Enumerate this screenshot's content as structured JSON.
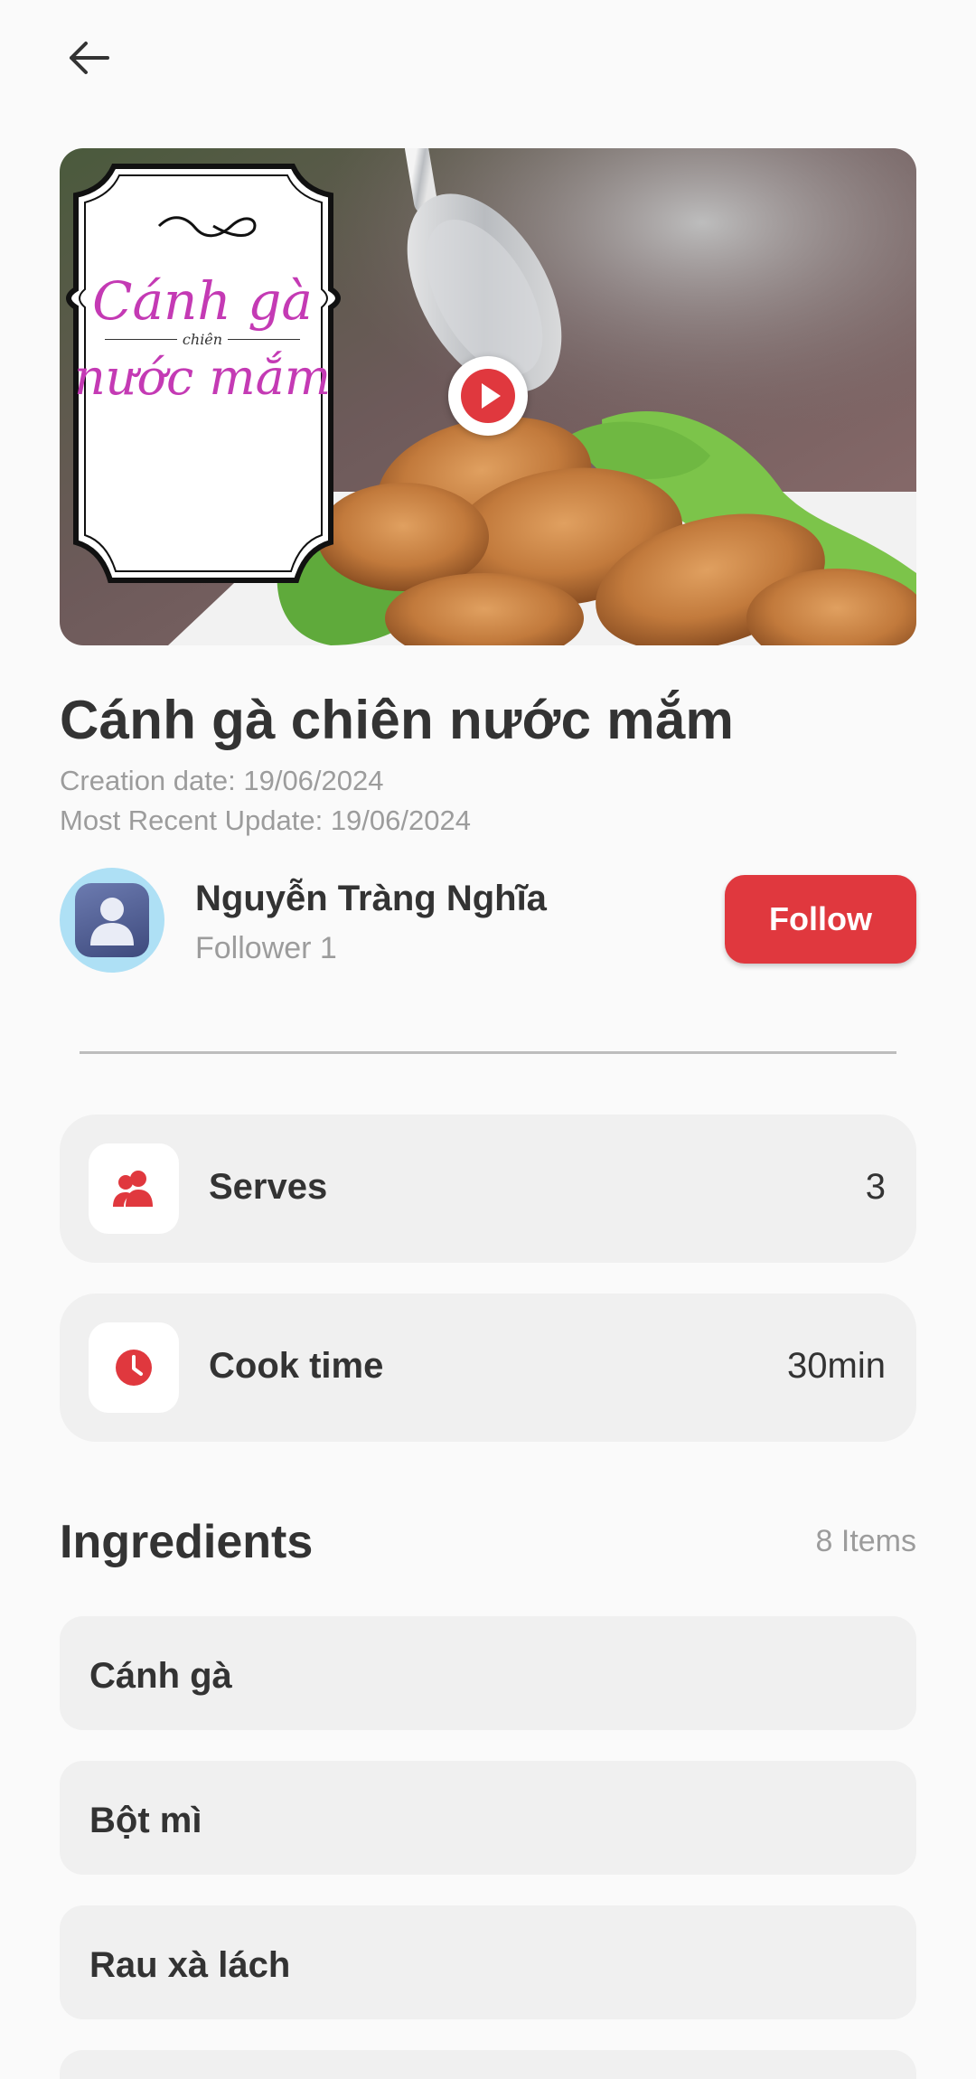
{
  "recipe": {
    "title": "Cánh gà chiên nước mắm",
    "creation_date": "Creation date: 19/06/2024",
    "updated_date": "Most Recent Update: 19/06/2024",
    "thumbnail_label": {
      "line1": "Cánh gà",
      "line2": "chiên",
      "line3": "nước mắm"
    }
  },
  "author": {
    "name": "Nguyễn Tràng Nghĩa",
    "followers": "Follower 1",
    "follow_label": "Follow"
  },
  "info": {
    "serves": {
      "label": "Serves",
      "value": "3",
      "icon": "people-icon"
    },
    "cook_time": {
      "label": "Cook time",
      "value": "30min",
      "icon": "clock-icon"
    }
  },
  "ingredients": {
    "title": "Ingredients",
    "count": "8 Items",
    "items": [
      "Cánh gà",
      "Bột mì",
      "Rau xà lách",
      ""
    ]
  },
  "colors": {
    "accent": "#e0383e",
    "background": "#fafafa",
    "card": "#f0f0f0"
  }
}
